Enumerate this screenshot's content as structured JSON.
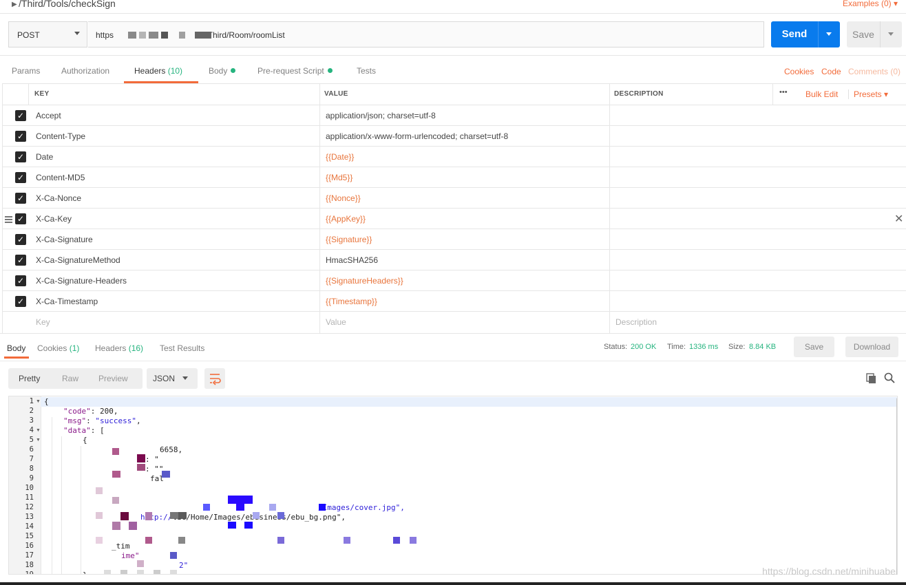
{
  "request": {
    "name": "/Third/Tools/checkSign",
    "examples_label": "Examples (0)",
    "method": "POST",
    "url_prefix": "https",
    "url_suffix": "m//Third/Room/roomList",
    "send_label": "Send",
    "save_label": "Save"
  },
  "request_tabs": [
    {
      "label": "Params"
    },
    {
      "label": "Authorization"
    },
    {
      "label": "Headers",
      "count": "(10)"
    },
    {
      "label": "Body"
    },
    {
      "label": "Pre-request Script"
    },
    {
      "label": "Tests"
    }
  ],
  "right_links": {
    "cookies": "Cookies",
    "code": "Code",
    "comments": "Comments (0)"
  },
  "headers_table": {
    "columns": {
      "key": "KEY",
      "value": "VALUE",
      "description": "DESCRIPTION"
    },
    "bulk_edit": "Bulk Edit",
    "presets": "Presets",
    "more": "•••",
    "rows": [
      {
        "key": "Accept",
        "value": "application/json; charset=utf-8"
      },
      {
        "key": "Content-Type",
        "value": "application/x-www-form-urlencoded; charset=utf-8"
      },
      {
        "key": "Date",
        "value": "{{Date}}"
      },
      {
        "key": "Content-MD5",
        "value": "{{Md5}}"
      },
      {
        "key": "X-Ca-Nonce",
        "value": "{{Nonce}}"
      },
      {
        "key": "X-Ca-Key",
        "value": "{{AppKey}}"
      },
      {
        "key": "X-Ca-Signature",
        "value": "{{Signature}}"
      },
      {
        "key": "X-Ca-SignatureMethod",
        "value": "HmacSHA256"
      },
      {
        "key": "X-Ca-Signature-Headers",
        "value": "{{SignatureHeaders}}"
      },
      {
        "key": "X-Ca-Timestamp",
        "value": "{{Timestamp}}"
      }
    ],
    "placeholders": {
      "key": "Key",
      "value": "Value",
      "description": "Description"
    }
  },
  "response": {
    "tabs": [
      {
        "label": "Body"
      },
      {
        "label": "Cookies",
        "count": "(1)"
      },
      {
        "label": "Headers",
        "count": "(16)"
      },
      {
        "label": "Test Results"
      }
    ],
    "status_label": "Status:",
    "status_value": "200 OK",
    "time_label": "Time:",
    "time_value": "1336 ms",
    "size_label": "Size:",
    "size_value": "8.84 KB",
    "save_label": "Save",
    "download_label": "Download",
    "formats": [
      "Pretty",
      "Raw",
      "Preview"
    ],
    "format_type": "JSON"
  },
  "code_lines": [
    {
      "n": "1",
      "text": "{"
    },
    {
      "n": "2",
      "key": "\"code\"",
      "rest": ": 200,"
    },
    {
      "n": "3",
      "key": "\"msg\"",
      "rest": ": ",
      "str": "\"success\"",
      "tail": ","
    },
    {
      "n": "4",
      "key": "\"data\"",
      "rest": ": ["
    },
    {
      "n": "5",
      "text": "{"
    },
    {
      "n": "6",
      "text": "6658,"
    },
    {
      "n": "7",
      "text": ": \""
    },
    {
      "n": "8",
      "text": ": \"\""
    },
    {
      "n": "9",
      "text": "fal"
    },
    {
      "n": "10",
      "text": ""
    },
    {
      "n": "11",
      "text": ""
    },
    {
      "n": "12",
      "str": "/Images/cover.jpg\","
    },
    {
      "n": "13",
      "str": "http://",
      "tail": "lic/Home/Images/ebusiness/ebu_bg.png\","
    },
    {
      "n": "14",
      "text": ""
    },
    {
      "n": "15",
      "text": ""
    },
    {
      "n": "16",
      "text": "_tim"
    },
    {
      "n": "17",
      "key": "ime\""
    },
    {
      "n": "18",
      "str": "2\""
    },
    {
      "n": "19",
      "text": "}"
    }
  ],
  "watermark": "https://blog.csdn.net/minihuabei",
  "colors": {
    "accent": "#f26b3a",
    "send": "#097bed",
    "success": "#26b47f",
    "variable": "#e8743b"
  }
}
